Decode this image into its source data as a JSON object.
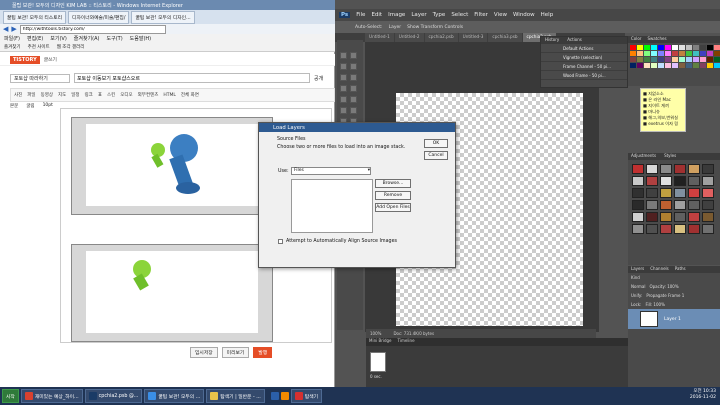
{
  "ie": {
    "title": "꿀팁 보관! 모두의 디자인 KIM LAB :: 티스토리 - Windows Internet Explorer",
    "tabs": [
      "꿀팁 보관! 모두의 티스토리",
      "디자이너와예술/미술/편집/",
      "꿀팁 보관! 모두의 디자인..."
    ],
    "url": "http://withtools.tistory.com/",
    "menu": [
      "파일(F)",
      "편집(E)",
      "보기(V)",
      "즐겨찾기(A)",
      "도구(T)",
      "도움말(H)"
    ],
    "favorites": [
      "즐겨찾기",
      "추천 사이트",
      "웹 조각 갤러리"
    ]
  },
  "tistory": {
    "logo": "TISTORY",
    "subtitle": "글쓰기",
    "category": "포토샵 따라하기",
    "post_title": "포토샵 이동보기 포토샵스오르",
    "visibility_public": "공개",
    "toolbar": [
      "사진",
      "파일",
      "동영상",
      "지도",
      "일정",
      "링크",
      "표",
      "스킨",
      "오디오",
      "외부컨텐츠",
      "HTML",
      "전체 화면"
    ],
    "font": "본문",
    "font_family": "굴림",
    "font_size": "10pt",
    "footer": [
      "임시저장",
      "미리보기",
      "발행"
    ]
  },
  "photoshop": {
    "menu": [
      "File",
      "Edit",
      "Image",
      "Layer",
      "Type",
      "Select",
      "Filter",
      "View",
      "Window",
      "Help"
    ],
    "logo": "Ps",
    "options": [
      "Auto-Select:",
      "Layer",
      "Show Transform Controls"
    ],
    "tabs": [
      "Untitled-1",
      "Untitled-2",
      "cpchia2.psb",
      "Untitled-3",
      "cpchia3.psb",
      "cpchia2.psb"
    ],
    "history_tabs": [
      "History",
      "Actions"
    ],
    "actions": [
      "Default Actions",
      "Vignette (selection)",
      "Frame Channel - 50 pi...",
      "Wood Frame - 50 pi..."
    ],
    "swatch_tabs": [
      "Color",
      "Swatches"
    ],
    "swatch_colors": [
      "#ff0000",
      "#ffff00",
      "#00ff00",
      "#00ffff",
      "#0000ff",
      "#ff00ff",
      "#ffffff",
      "#e0e0e0",
      "#c0c0c0",
      "#808080",
      "#404040",
      "#000000",
      "#ff8080",
      "#ff8000",
      "#ffc080",
      "#80ff80",
      "#80ffff",
      "#8080ff",
      "#ff80ff",
      "#c04040",
      "#c08040",
      "#40c040",
      "#40c0c0",
      "#4040c0",
      "#c040c0",
      "#804000",
      "#804040",
      "#808040",
      "#408040",
      "#408080",
      "#404080",
      "#804080",
      "#ffd0a0",
      "#a0ffd0",
      "#a0d0ff",
      "#d0a0ff",
      "#ffa0d0",
      "#602000",
      "#006020",
      "#002060",
      "#600060",
      "#ffe0c0",
      "#e0ffc0",
      "#c0e0ff",
      "#ffc0e0",
      "#e0c0ff",
      "#806040",
      "#406080",
      "#608040",
      "#804060",
      "#ffcc00",
      "#00ccff"
    ],
    "sticky": [
      "■ 지없소소",
      "■ 은 라인 Mac",
      "■ 지이트 게끼",
      "■ 마니슈",
      "■ 해그,의보,번워실",
      "■ exetrus 이자 링"
    ],
    "adjust_tabs": [
      "Adjustments",
      "Styles"
    ],
    "style_colors": [
      "#c03030",
      "#d8d8d8",
      "#8a8a8a",
      "#a03030",
      "#d0a060",
      "#3a3a3a",
      "#c8c8c8",
      "#b04040",
      "#e0e0e0",
      "#202020",
      "#606060",
      "#a0a0a0",
      "#303030",
      "#404040",
      "#c0a040",
      "#8090a0",
      "#d04040",
      "#e06060",
      "#2a2a2a",
      "#7a7a7a",
      "#c06030",
      "#a0a0a0",
      "#606060",
      "#404040",
      "#d0d0d0",
      "#502020",
      "#b08030",
      "#606060",
      "#c04040",
      "#7a5a30",
      "#909090",
      "#505050",
      "#b04040",
      "#d8c080",
      "#a03030",
      "#707070"
    ],
    "layer_tabs": [
      "Layers",
      "Channels",
      "Paths"
    ],
    "layers_controls": [
      "Kind",
      "Normal",
      "Opacity: 100%",
      "Lock:",
      "Fill: 100%",
      "Propagate Frame 1",
      "Unify:"
    ],
    "layer_name": "Layer 1",
    "zoom": "100%",
    "doc_size": "Doc: 731.4K/0 bytes",
    "timeline_tabs": [
      "Mini Bridge",
      "Timeline"
    ],
    "frame_time": "0 sec."
  },
  "dialog": {
    "title": "Load Layers",
    "section": "Source Files",
    "instruction": "Choose two or more files to load into an image stack.",
    "use_label": "Use:",
    "use_value": "Files",
    "buttons": [
      "Browse...",
      "Remove",
      "Add Open Files"
    ],
    "ok": "OK",
    "cancel": "Cancel",
    "checkbox_label": "Attempt to Automatically Align Source Images"
  },
  "taskbar": {
    "start": "시작",
    "tasks": [
      "재미있는 예상_하이...",
      "cpchia2.psb @...",
      "꿀팁 보관! 모두의 ...",
      "탐색기 | 일반운 - ...",
      "탐색기"
    ],
    "clock_time": "오전 10:33",
    "clock_date": "2016-11-02"
  }
}
